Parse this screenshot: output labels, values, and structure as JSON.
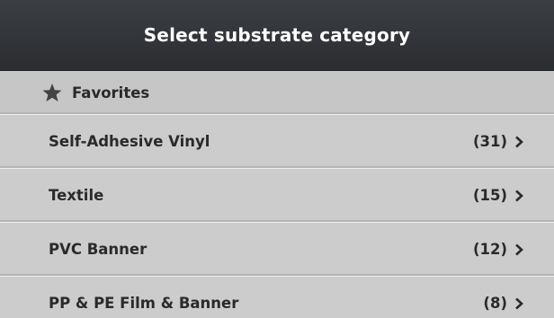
{
  "header": {
    "title": "Select substrate category"
  },
  "favorites": {
    "label": "Favorites",
    "icon": "star-icon"
  },
  "categories": [
    {
      "label": "Self-Adhesive Vinyl",
      "count": "(31)"
    },
    {
      "label": "Textile",
      "count": "(15)"
    },
    {
      "label": "PVC Banner",
      "count": "(12)"
    },
    {
      "label": "PP & PE Film & Banner",
      "count": "(8)"
    }
  ],
  "colors": {
    "header_bg": "#2f3136",
    "list_bg": "#cccccc",
    "text": "#2a2a2a"
  }
}
